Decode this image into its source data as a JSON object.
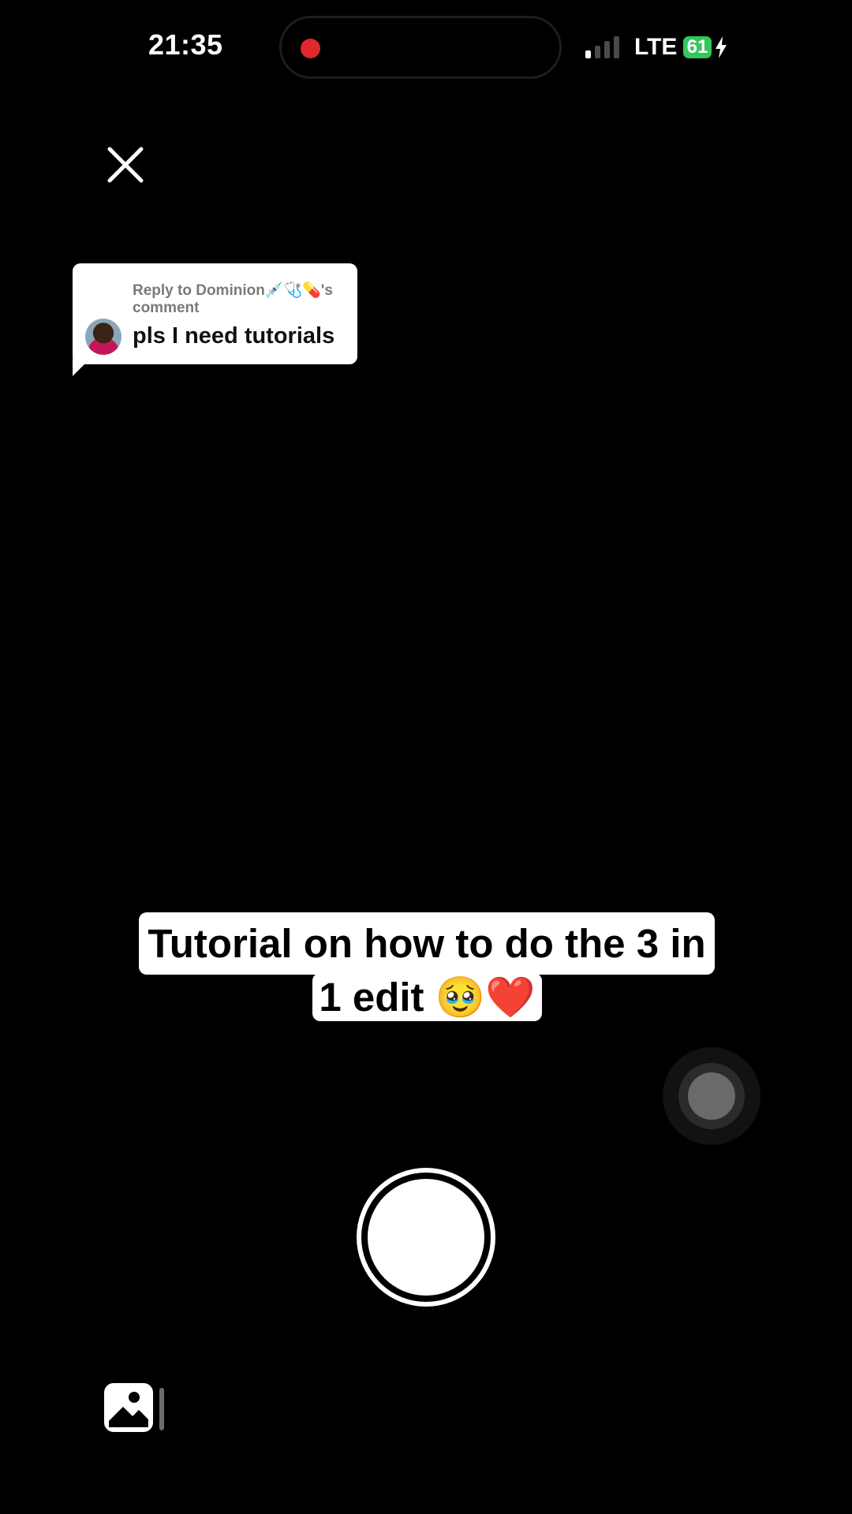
{
  "status_bar": {
    "time": "21:35",
    "network": "LTE",
    "battery": "61",
    "battery_color": "#34c759",
    "recording_color": "#e0282d",
    "signal_bars_on": 1,
    "signal_bars_total": 4
  },
  "reply": {
    "header": "Reply to Dominion💉🩺💊's comment",
    "text": "pls I need tutorials"
  },
  "caption": {
    "line1": "Tutorial on how to do the 3 in",
    "line2": "1 edit 🥹❤️"
  },
  "icons": {
    "close": "close-icon",
    "flip_camera": "flip-camera-icon",
    "shutter": "shutter-icon",
    "gallery": "gallery-icon",
    "recording": "recording-dot-icon",
    "signal": "signal-icon",
    "battery": "battery-icon",
    "charging": "bolt-icon"
  }
}
